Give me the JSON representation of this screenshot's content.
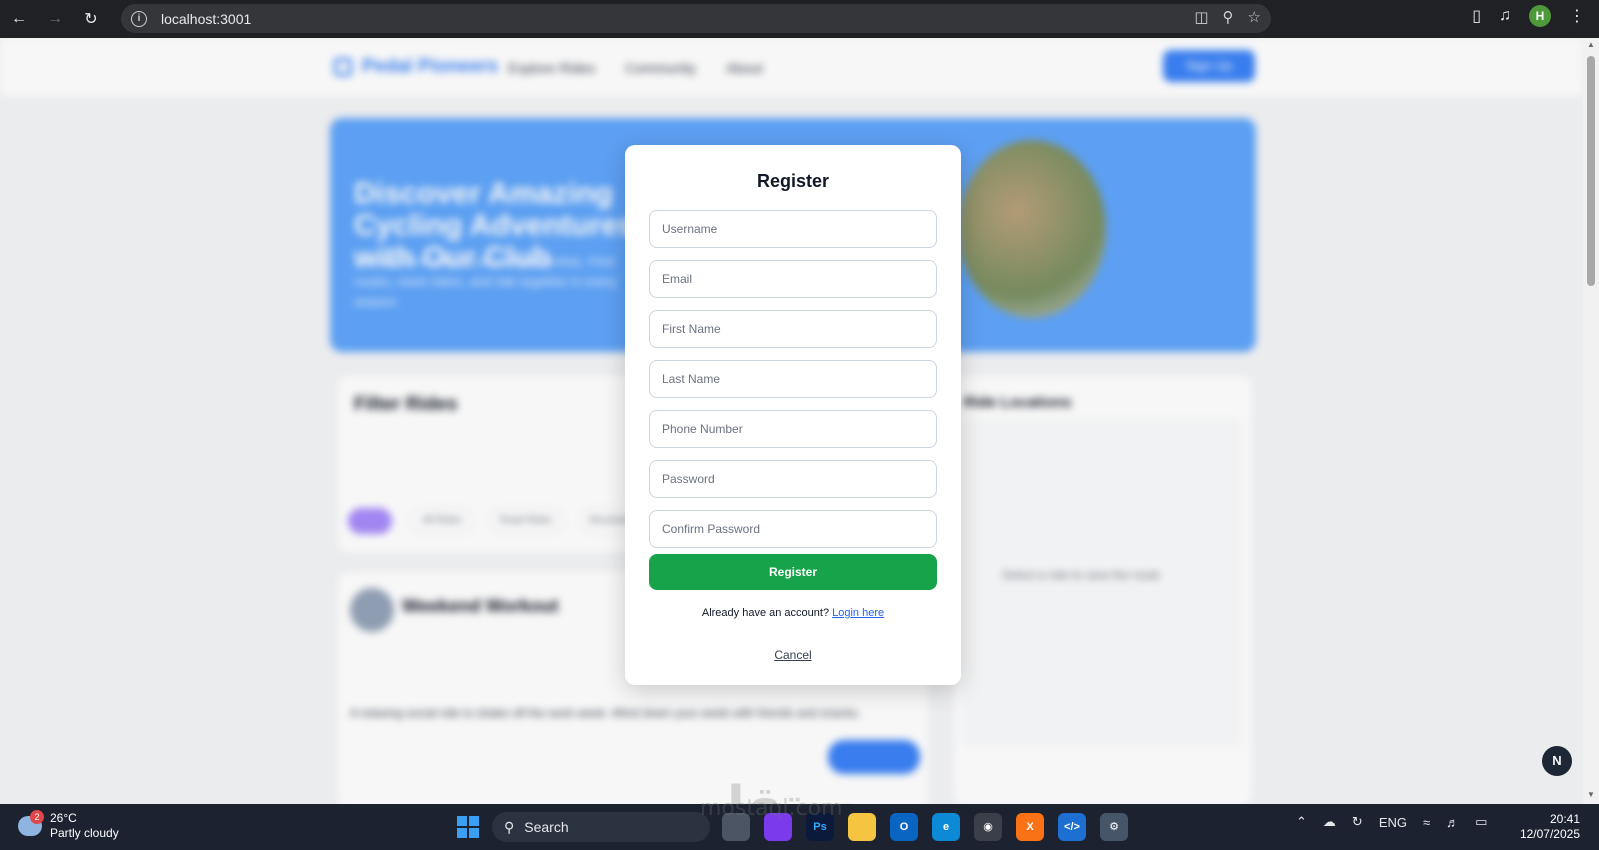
{
  "browser": {
    "url": "localhost:3001"
  },
  "page_background": {
    "logo_text": "Pedal Pioneers",
    "nav": [
      "Explore Rides",
      "Community",
      "About"
    ],
    "cta_label": "Sign Up",
    "hero_title": "Discover Amazing Cycling Adventures with Our Club",
    "hero_subtitle": "Join a community of passionate cyclists. Find routes, meet riders, and ride together in every season.",
    "filter_title": "Filter Rides",
    "chips": [
      "",
      "All Rides",
      "Road Rides",
      "Mountain"
    ],
    "locations_title": "Ride Locations",
    "locations_empty": "Select a ride to view the route",
    "ride_name": "Weekend Workout",
    "ride_desc": "A relaxing social ride to shake off the work week. Wind down your week with friends and snacks.",
    "next_badge": "N"
  },
  "modal": {
    "title": "Register",
    "fields": {
      "username": "Username",
      "email": "Email",
      "first_name": "First Name",
      "last_name": "Last Name",
      "phone": "Phone Number",
      "password": "Password",
      "confirm_password": "Confirm Password"
    },
    "register_label": "Register",
    "already_text": "Already have an account?",
    "login_link": "Login here",
    "cancel_label": "Cancel"
  },
  "watermark": {
    "arabic": "مستقل",
    "latin": "mostaql.com"
  },
  "taskbar": {
    "weather_temp": "26°C",
    "weather_desc": "Partly cloudy",
    "weather_badge": "2",
    "search_label": "Search",
    "lang": "ENG",
    "time": "20:41",
    "date": "12/07/2025"
  },
  "colors": {
    "register_button": "#16a34a",
    "login_link": "#2563eb",
    "brand_blue": "#3b82f6"
  }
}
